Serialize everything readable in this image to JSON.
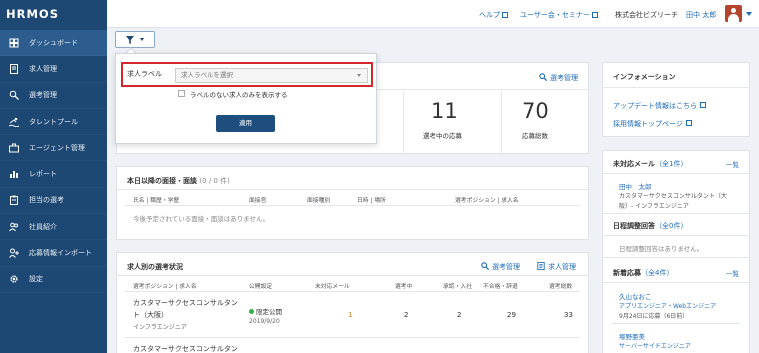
{
  "app": {
    "logo": "HRMOS"
  },
  "sidebar": {
    "items": [
      {
        "label": "ダッシュボード",
        "icon": "dashboard-icon",
        "active": true
      },
      {
        "label": "求人管理",
        "icon": "document-icon"
      },
      {
        "label": "選考管理",
        "icon": "search-person-icon"
      },
      {
        "label": "タレントプール",
        "icon": "swimmer-icon"
      },
      {
        "label": "エージェント管理",
        "icon": "briefcase-icon"
      },
      {
        "label": "レポート",
        "icon": "bar-chart-icon"
      },
      {
        "label": "担当の選考",
        "icon": "clipboard-icon"
      },
      {
        "label": "社員紹介",
        "icon": "people-icon"
      },
      {
        "label": "応募情報インポート",
        "icon": "import-icon"
      },
      {
        "label": "設定",
        "icon": "gear-icon"
      }
    ]
  },
  "header": {
    "help": "ヘルプ",
    "community": "ユーザー会・セミナー",
    "company": "株式会社ビズリーチ",
    "user": "田中 太郎"
  },
  "filter_popup": {
    "label": "求人ラベル",
    "select_placeholder": "求人ラベルを選択",
    "checkbox_label": "ラベルのない求人のみを表示する",
    "apply": "適用"
  },
  "summary": {
    "manage_link": "選考管理",
    "stats": [
      {
        "value": "11",
        "label": "選考中の応募"
      },
      {
        "value": "70",
        "label": "応募総数"
      }
    ]
  },
  "interviews": {
    "title": "本日以降の面接・面談",
    "count": "(0 / 0 件)",
    "columns": [
      "氏名 | 職歴・学歴",
      "面接官",
      "面接種別",
      "日時 | 場所",
      "選考ポジション | 求人名"
    ],
    "empty": "今後予定されている面接・面談はありません。"
  },
  "jobs": {
    "title": "求人別の選考状況",
    "manage_link": "選考管理",
    "job_link": "求人管理",
    "columns": [
      "選考ポジション | 求人名",
      "公開設定",
      "未対応メール",
      "選考中",
      "承認・入社",
      "不合格・辞退",
      "選考総数"
    ],
    "rows": [
      {
        "name": "カスタマーサクセスコンサルタント（大阪）",
        "name_line1": "カスタマーサクセスコンサルタン",
        "name_line2": "ト（大阪）",
        "sub": "インフラエンジニア",
        "status": "限定公開",
        "date": "2019/9/20",
        "unread": "1",
        "in_progress": "2",
        "approved": "2",
        "rejected": "29",
        "total": "33"
      },
      {
        "name_line1": "カスタマーサクセスコンサルタン"
      }
    ]
  },
  "info": {
    "title": "インフォメーション",
    "links": [
      "アップデート情報はこちら",
      "採用情報トップページ"
    ]
  },
  "unread_mail": {
    "title": "未対応メール",
    "count": "（全1件）",
    "view_all": "一覧",
    "name": "田中　太郎",
    "detail_line1": "カスタマーサクセスコンサルタント（大",
    "detail_line2": "阪）- インフラエンジニア"
  },
  "schedule": {
    "title": "日程調整回答",
    "count": "（全0件）",
    "empty": "日程調整回答はありません。"
  },
  "new_applications": {
    "title": "新着応募",
    "count": "（全4件）",
    "view_all": "一覧",
    "items": [
      {
        "name": "久山なおこ",
        "position": "アプリエンジニア・Webエンジニア",
        "date": "9月24日に応募（6日前）"
      },
      {
        "name": "塚野亜美",
        "position": "サーバーサイドエンジニア"
      }
    ]
  }
}
